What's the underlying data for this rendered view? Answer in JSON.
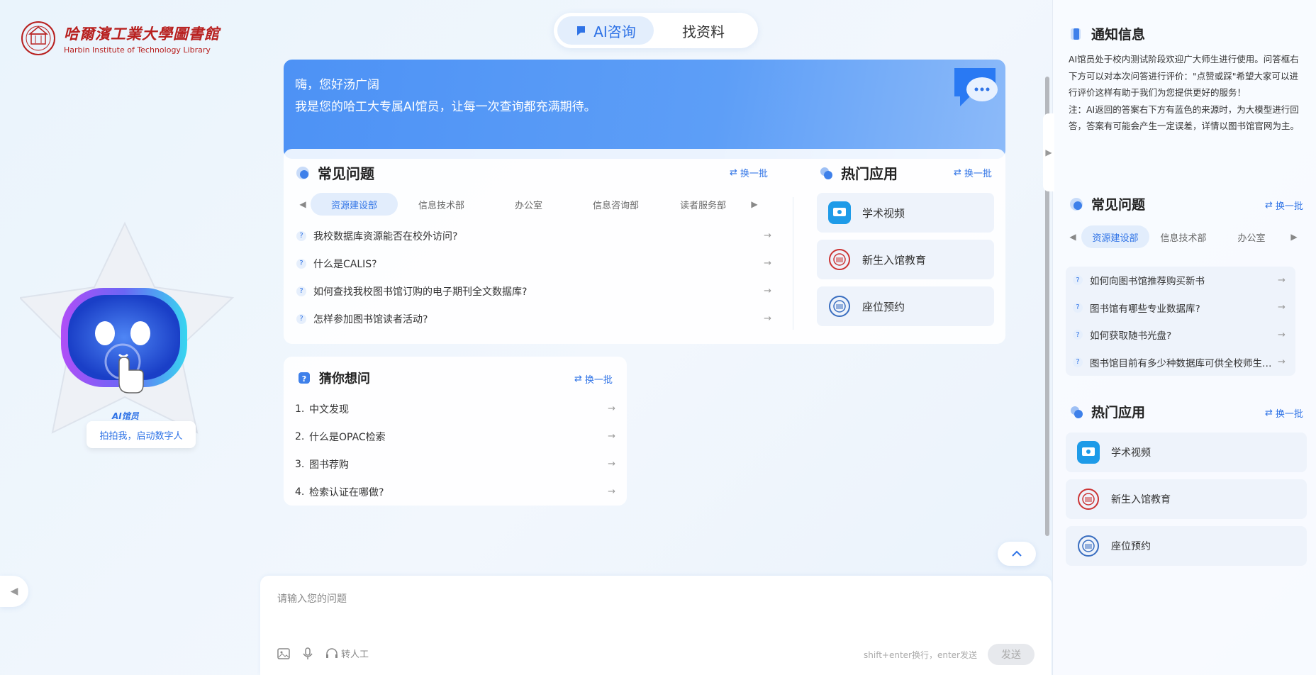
{
  "logo": {
    "cn": "哈爾濱工業大學圖書館",
    "en": "Harbin Institute of Technology Library"
  },
  "topnav": {
    "ai_tab": "AI咨询",
    "search_tab": "找资料"
  },
  "hero": {
    "greeting": "嗨，您好汤广阔",
    "intro": "我是您的哈工大专属AI馆员，让每一次查询都充满期待。"
  },
  "faq": {
    "title": "常见问题",
    "swap": "换一批",
    "categories": [
      "资源建设部",
      "信息技术部",
      "办公室",
      "信息咨询部",
      "读者服务部"
    ],
    "questions": [
      "我校数据库资源能否在校外访问?",
      "什么是CALIS?",
      "如何查找我校图书馆订购的电子期刊全文数据库?",
      "怎样参加图书馆读者活动?"
    ]
  },
  "hot": {
    "title": "热门应用",
    "swap": "换一批",
    "apps": [
      "学术视频",
      "新生入馆教育",
      "座位预约"
    ]
  },
  "guess": {
    "title": "猜你想问",
    "swap": "换一批",
    "items": [
      {
        "n": "1.",
        "t": "中文发现"
      },
      {
        "n": "2.",
        "t": "什么是OPAC检索"
      },
      {
        "n": "3.",
        "t": "图书荐购"
      },
      {
        "n": "4.",
        "t": "检索认证在哪做?"
      }
    ]
  },
  "robot": {
    "name": "AI馆员",
    "cta": "拍拍我，启动数字人"
  },
  "input": {
    "placeholder": "请输入您的问题",
    "transfer": "转人工",
    "hint": "shift+enter换行，enter发送",
    "send": "发送"
  },
  "panel": {
    "notice_title": "通知信息",
    "notice_p1": "AI馆员处于校内测试阶段欢迎广大师生进行使用。问答框右下方可以对本次问答进行评价：\"点赞或踩\"希望大家可以进行评价这样有助于我们为您提供更好的服务！",
    "notice_p2": "注：AI返回的答案右下方有蓝色的来源时，为大模型进行回答，答案有可能会产生一定误差，详情以图书馆官网为主。",
    "faq_title": "常见问题",
    "faq_swap": "换一批",
    "faq_categories": [
      "资源建设部",
      "信息技术部",
      "办公室"
    ],
    "faq_questions": [
      "如何向图书馆推荐购买新书",
      "图书馆有哪些专业数据库?",
      "如何获取随书光盘?",
      "图书馆目前有多少种数据库可供全校师生使用"
    ],
    "hot_title": "热门应用",
    "hot_swap": "换一批",
    "hot_apps": [
      "学术视频",
      "新生入馆教育",
      "座位预约"
    ]
  },
  "colors": {
    "accent": "#2f73e6",
    "hero_start": "#4d92f5",
    "brand_red": "#b8201f"
  }
}
